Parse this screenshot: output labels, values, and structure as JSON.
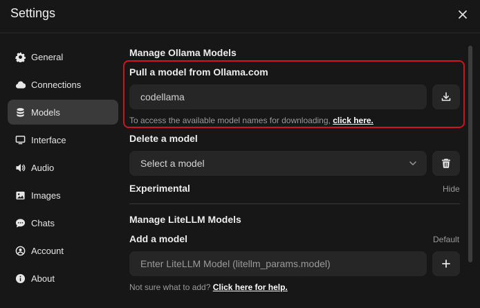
{
  "window": {
    "title": "Settings"
  },
  "sidebar": {
    "items": [
      {
        "label": "General",
        "icon": "gear-icon",
        "active": false
      },
      {
        "label": "Connections",
        "icon": "cloud-icon",
        "active": false
      },
      {
        "label": "Models",
        "icon": "database-icon",
        "active": true
      },
      {
        "label": "Interface",
        "icon": "monitor-icon",
        "active": false
      },
      {
        "label": "Audio",
        "icon": "speaker-icon",
        "active": false
      },
      {
        "label": "Images",
        "icon": "image-icon",
        "active": false
      },
      {
        "label": "Chats",
        "icon": "chat-bubble-icon",
        "active": false
      },
      {
        "label": "Account",
        "icon": "user-circle-icon",
        "active": false
      },
      {
        "label": "About",
        "icon": "info-icon",
        "active": false
      }
    ]
  },
  "ollama": {
    "section_title": "Manage Ollama Models",
    "pull": {
      "title": "Pull a model from Ollama.com",
      "input_value": "codellama",
      "hint_text": "To access the available model names for downloading,",
      "hint_link": "click here."
    },
    "delete": {
      "title": "Delete a model",
      "select_value": "Select a model"
    },
    "experimental": {
      "title": "Experimental",
      "toggle_label": "Hide"
    }
  },
  "litellm": {
    "section_title": "Manage LiteLLM Models",
    "add": {
      "title": "Add a model",
      "mode_label": "Default",
      "input_placeholder": "Enter LiteLLM Model (litellm_params.model)",
      "hint_text": "Not sure what to add?",
      "hint_link": "Click here for help."
    }
  },
  "colors": {
    "background": "#171717",
    "active_nav": "#3a3a3a",
    "field": "#262626",
    "highlight": "#d0131d"
  }
}
